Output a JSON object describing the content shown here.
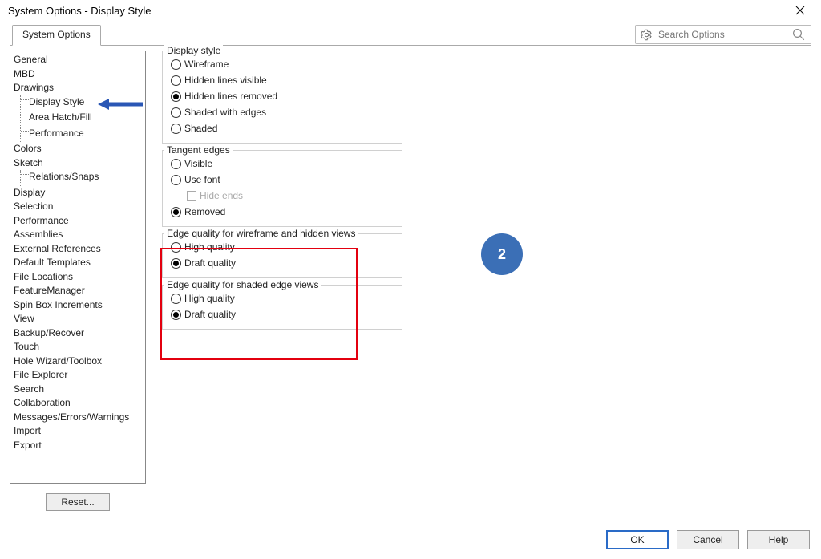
{
  "window": {
    "title": "System Options - Display Style"
  },
  "search": {
    "placeholder": "Search Options"
  },
  "tabs": {
    "system_options": "System Options"
  },
  "nav": {
    "general": "General",
    "mbd": "MBD",
    "drawings": "Drawings",
    "drawings_children": {
      "display_style": "Display Style",
      "area_hatch": "Area Hatch/Fill",
      "performance": "Performance"
    },
    "colors": "Colors",
    "sketch": "Sketch",
    "sketch_children": {
      "relations_snaps": "Relations/Snaps"
    },
    "display": "Display",
    "selection": "Selection",
    "performance": "Performance",
    "assemblies": "Assemblies",
    "external_references": "External References",
    "default_templates": "Default Templates",
    "file_locations": "File Locations",
    "featuremanager": "FeatureManager",
    "spin_box": "Spin Box Increments",
    "view": "View",
    "backup_recover": "Backup/Recover",
    "touch": "Touch",
    "hole_wizard": "Hole Wizard/Toolbox",
    "file_explorer": "File Explorer",
    "search": "Search",
    "collaboration": "Collaboration",
    "messages": "Messages/Errors/Warnings",
    "import": "Import",
    "export": "Export"
  },
  "reset_label": "Reset...",
  "groups": {
    "display_style": {
      "title": "Display style",
      "wireframe": "Wireframe",
      "hidden_visible": "Hidden lines visible",
      "hidden_removed": "Hidden lines removed",
      "shaded_edges": "Shaded with edges",
      "shaded": "Shaded",
      "selected": "hidden_removed"
    },
    "tangent_edges": {
      "title": "Tangent edges",
      "visible": "Visible",
      "use_font": "Use font",
      "hide_ends": "Hide ends",
      "removed": "Removed",
      "selected": "removed"
    },
    "edge_wireframe": {
      "title": "Edge quality for wireframe and hidden views",
      "high": "High quality",
      "draft": "Draft quality",
      "selected": "draft"
    },
    "edge_shaded": {
      "title": "Edge quality for shaded edge views",
      "high": "High quality",
      "draft": "Draft quality",
      "selected": "draft"
    }
  },
  "buttons": {
    "ok": "OK",
    "cancel": "Cancel",
    "help": "Help"
  },
  "annotations": {
    "callout_number": "2"
  }
}
